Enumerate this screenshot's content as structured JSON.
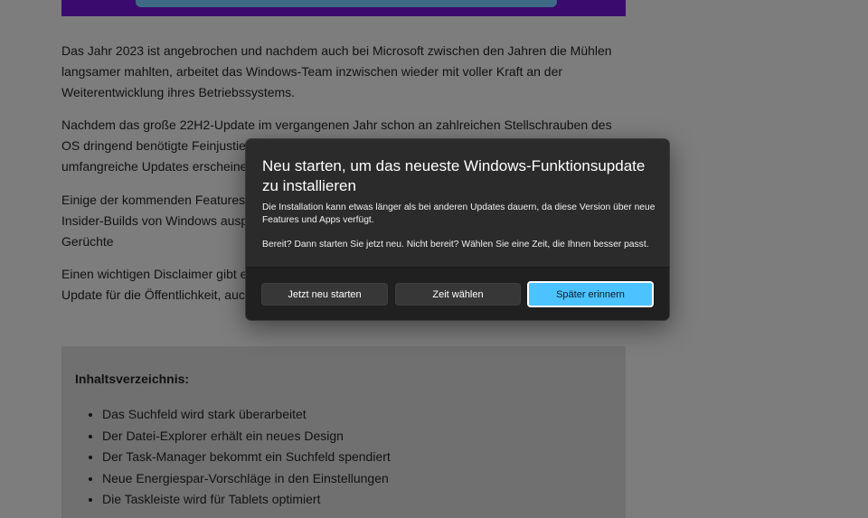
{
  "article": {
    "paragraphs": [
      "Das Jahr 2023 ist angebrochen und nachdem auch bei Microsoft zwischen den Jahren die Mühlen langsamer mahlten, arbeitet das Windows-Team inzwischen wieder mit voller Kraft an der Weiterentwicklung ihres Betriebssystems.",
      "Nachdem das große 22H2-Update im vergangenen Jahr schon an zahlreichen Stellschrauben des OS dringend benötigte Feinjustierung vorgenommen hat, sollen auch in diesem Jahr wieder umfangreiche Updates erscheinen,",
      "Einige der kommenden Features sind bereits bekannt und können schon jetzt in den aktuellen Insider-Builds von Windows ausprobiert werden. Wir sammeln sie in diesem Artikel also nicht auf Gerüchte",
      "Einen wichtigen Disclaimer gibt es allerdings: Nicht alle der Insider-Features schaffen es ins finale Update für die Öffentlichkeit, auch wenn sich Microsoft mit eine Neuerung ganz besonders freut"
    ],
    "toc": {
      "title": "Inhaltsverzeichnis:",
      "items": [
        "Das Suchfeld wird stark überarbeitet",
        "Der Datei-Explorer erhält ein neues Design",
        "Der Task-Manager bekommt ein Suchfeld spendiert",
        "Neue Energiespar-Vorschläge in den Einstellungen",
        "Die Taskleiste wird für Tablets optimiert"
      ]
    }
  },
  "dialog": {
    "title": "Neu starten, um das neueste Windows-Funktionsupdate zu installieren",
    "body": "Die Installation kann etwas länger als bei anderen Updates dauern, da diese Version über neue Features und Apps verfügt.",
    "body2": "Bereit? Dann starten Sie jetzt neu. Nicht bereit? Wählen Sie eine Zeit, die Ihnen besser passt.",
    "buttons": {
      "restart": "Jetzt neu starten",
      "choose_time": "Zeit wählen",
      "later": "Später erinnern"
    },
    "accent_color": "#4cc2ff"
  }
}
